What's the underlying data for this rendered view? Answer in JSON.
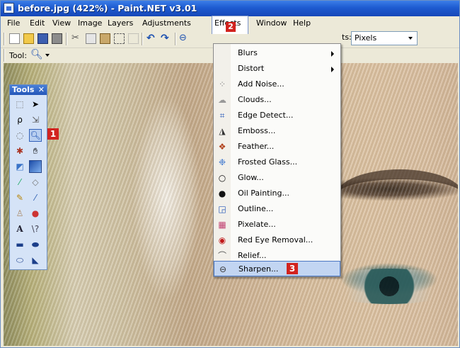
{
  "window": {
    "title": "before.jpg (422%) - Paint.NET v3.01"
  },
  "menubar": {
    "items": [
      {
        "label": "File"
      },
      {
        "label": "Edit"
      },
      {
        "label": "View"
      },
      {
        "label": "Image"
      },
      {
        "label": "Layers"
      },
      {
        "label": "Adjustments"
      },
      {
        "label": "Effects"
      },
      {
        "label": "Window"
      },
      {
        "label": "Help"
      }
    ]
  },
  "toolbar": {
    "units_label": "ts:",
    "units_value": "Pixels",
    "tool_label": "Tool:"
  },
  "tools_panel": {
    "title": "Tools",
    "close": "✕"
  },
  "badges": {
    "one": "1",
    "two": "2",
    "three": "3"
  },
  "effects_menu": {
    "items": [
      {
        "label": "Blurs",
        "icon": "",
        "submenu": true
      },
      {
        "label": "Distort",
        "icon": "",
        "submenu": true
      },
      {
        "label": "Add Noise...",
        "icon": "noise-icon"
      },
      {
        "label": "Clouds...",
        "icon": "clouds-icon"
      },
      {
        "label": "Edge Detect...",
        "icon": "edge-detect-icon"
      },
      {
        "label": "Emboss...",
        "icon": "emboss-icon"
      },
      {
        "label": "Feather...",
        "icon": "feather-icon"
      },
      {
        "label": "Frosted Glass...",
        "icon": "frosted-glass-icon"
      },
      {
        "label": "Glow...",
        "icon": "glow-icon"
      },
      {
        "label": "Oil Painting...",
        "icon": "oil-painting-icon"
      },
      {
        "label": "Outline...",
        "icon": "outline-icon"
      },
      {
        "label": "Pixelate...",
        "icon": "pixelate-icon"
      },
      {
        "label": "Red Eye Removal...",
        "icon": "red-eye-icon"
      },
      {
        "label": "Relief...",
        "icon": "relief-icon"
      },
      {
        "label": "Sharpen...",
        "icon": "sharpen-icon"
      }
    ]
  },
  "colors": {
    "title_bar": "#1e5bd0",
    "highlight": "#c2d5f2",
    "badge": "#d2231f"
  }
}
